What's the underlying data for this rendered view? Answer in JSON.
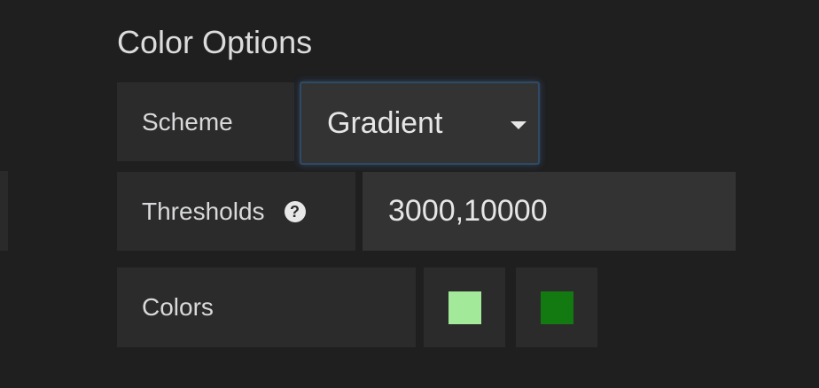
{
  "section": {
    "title": "Color Options"
  },
  "scheme": {
    "label": "Scheme",
    "selected": "Gradient"
  },
  "thresholds": {
    "label": "Thresholds",
    "help_icon": "question-circle-icon",
    "value": "3000,10000"
  },
  "colors": {
    "label": "Colors",
    "swatches": [
      "#a3e99a",
      "#137a12"
    ]
  }
}
